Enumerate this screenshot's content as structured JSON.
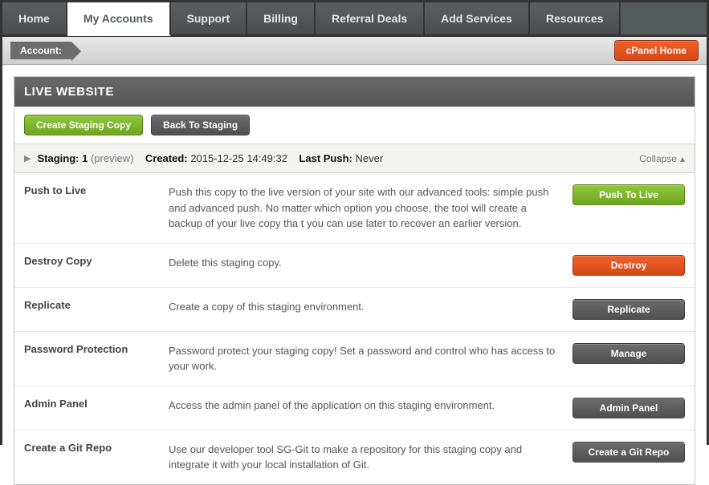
{
  "nav": {
    "tabs": [
      "Home",
      "My Accounts",
      "Support",
      "Billing",
      "Referral Deals",
      "Add Services",
      "Resources"
    ],
    "active_index": 1
  },
  "account_bar": {
    "label": "Account:",
    "cpanel_home": "cPanel Home"
  },
  "panel": {
    "title": "LIVE WEBSITE",
    "create_staging": "Create Staging Copy",
    "back_to_staging": "Back To Staging"
  },
  "staging": {
    "staging_label": "Staging:",
    "staging_num": "1",
    "staging_suffix": "(preview)",
    "created_label": "Created:",
    "created_val": "2015-12-25 14:49:32",
    "lastpush_label": "Last Push:",
    "lastpush_val": "Never",
    "collapse": "Collapse"
  },
  "rows": [
    {
      "label": "Push to Live",
      "desc": "Push this copy to the live version of your site with our advanced tools: simple push and advanced push. No matter which option you choose, the tool will create a backup of your live copy tha t you can use later to recover an earlier version.",
      "action": "Push To Live",
      "style": "green"
    },
    {
      "label": "Destroy Copy",
      "desc": "Delete this staging copy.",
      "action": "Destroy",
      "style": "orange"
    },
    {
      "label": "Replicate",
      "desc": "Create a copy of this staging environment.",
      "action": "Replicate",
      "style": "gray"
    },
    {
      "label": "Password Protection",
      "desc": "Password protect your staging copy! Set a password and control who has access to your work.",
      "action": "Manage",
      "style": "gray"
    },
    {
      "label": "Admin Panel",
      "desc": "Access the admin panel of the application on this staging environment.",
      "action": "Admin Panel",
      "style": "gray"
    },
    {
      "label": "Create a Git Repo",
      "desc": "Use our developer tool SG-Git to make a repository for this staging copy and integrate it with your local installation of Git.",
      "action": "Create a Git Repo",
      "style": "gray"
    }
  ]
}
